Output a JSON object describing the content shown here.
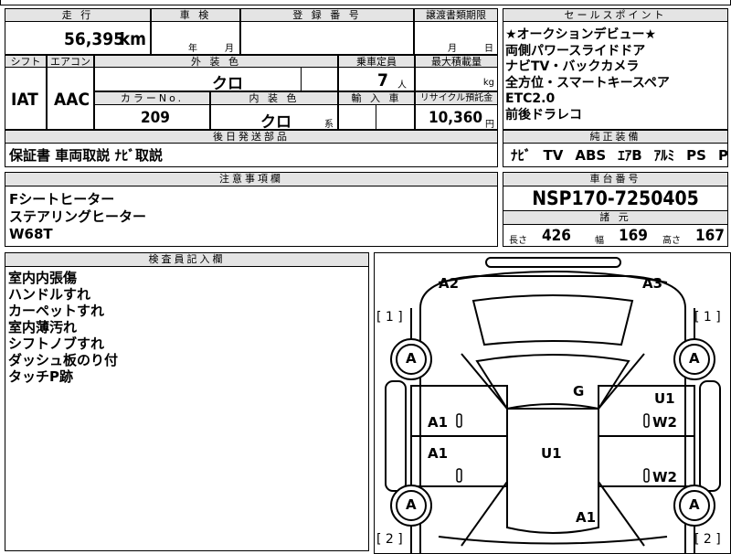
{
  "top_header": {
    "mileage_label": "走 行",
    "shaken_label": "車 検",
    "registration_label": "登 録 番 号",
    "transfer_doc_label": "譲渡書類期限",
    "mileage_value": "56,395",
    "mileage_unit": "km",
    "year_label": "年",
    "month_label": "月",
    "transfer_month_label": "月",
    "transfer_day_label": "日"
  },
  "sales_points": {
    "header": "セールスポイント",
    "lines": [
      "★オークションデビュー★",
      "両側パワースライドドア",
      "ナビTV・バックカメラ",
      "全方位・スマートキースペア",
      "ETC2.0",
      "前後ドラレコ"
    ]
  },
  "spec": {
    "shift_label": "シフト",
    "aircon_label": "エアコン",
    "exterior_label": "外 装 色",
    "capacity_label": "乗車定員",
    "max_load_label": "最大積載量",
    "shift_value": "IAT",
    "aircon_value": "AAC",
    "exterior_value": "クロ",
    "capacity_value": "7",
    "capacity_unit": "人",
    "max_load_unit": "kg",
    "color_no_label": "カラーNo.",
    "interior_label": "内 装 色",
    "import_label": "輸 入 車",
    "recycle_label": "リサイクル預託金",
    "color_no_value": "209",
    "interior_value": "クロ",
    "interior_suffix": "系",
    "recycle_value": "10,360",
    "recycle_unit": "円"
  },
  "later_parts": {
    "header": "後日発送部品",
    "value": "保証書 車両取説 ﾅﾋﾞ取説"
  },
  "equipment": {
    "header": "純正装備",
    "items": [
      "ﾅﾋﾞ",
      "TV",
      "ABS",
      "ｴｱB",
      "ｱﾙﾐ",
      "PS",
      "PW"
    ]
  },
  "notes": {
    "header": "注意事項欄",
    "lines": [
      "Fシートヒーター",
      "ステアリングヒーター",
      "W68T"
    ]
  },
  "chassis": {
    "header": "車台番号",
    "value": "NSP170-7250405"
  },
  "dimensions": {
    "header": "諸 元",
    "length_label": "長さ",
    "length_value": "426",
    "width_label": "幅",
    "width_value": "169",
    "height_label": "高さ",
    "height_value": "167"
  },
  "inspector": {
    "header": "検査員記入欄",
    "lines": [
      "室内内張傷",
      "ハンドルすれ",
      "カーペットすれ",
      "室内薄汚れ",
      "シフトノブすれ",
      "ダッシュ板のり付",
      "タッチP跡"
    ]
  },
  "diagram": {
    "marks": {
      "front_left_corner": "A2",
      "front_right_corner": "A3",
      "windshield": "G",
      "roof": "U1",
      "left_front_door": "A1",
      "left_rear_door": "A1",
      "right_front_door_upper": "U1",
      "right_front_door_lower": "W2",
      "right_rear_door": "W2",
      "rear_bumper": "A1",
      "front_left_wheel": "A",
      "front_right_wheel": "A",
      "rear_left_wheel": "A",
      "rear_right_wheel": "A"
    },
    "bracket_front_left": "[ 1 ]",
    "bracket_front_right": "[ 1 ]",
    "bracket_rear_left": "[ 2 ]",
    "bracket_rear_right": "[ 2 ]"
  }
}
